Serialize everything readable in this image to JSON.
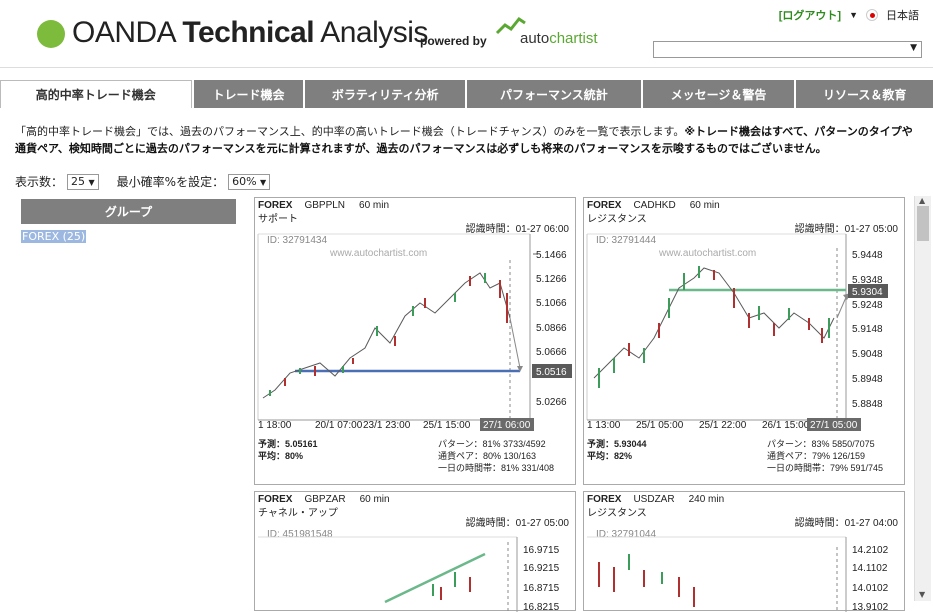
{
  "header": {
    "brand_bold": "OANDA",
    "brand_product_bold": "Technical",
    "brand_product_thin": " Analysis",
    "powered_by": "powered by",
    "partner_pre": "auto",
    "partner_post": "chartist",
    "logout": "[ログアウト]",
    "language": "日本語"
  },
  "tabs": [
    {
      "label": "高的中率トレード機会",
      "active": true
    },
    {
      "label": "トレード機会"
    },
    {
      "label": "ボラティリティ分析"
    },
    {
      "label": "パフォーマンス統計"
    },
    {
      "label": "メッセージ＆警告"
    },
    {
      "label": "リソース＆教育"
    }
  ],
  "description": {
    "normal": "「高的中率トレード機会」では、過去のパフォーマンス上、的中率の高いトレード機会（トレードチャンス）のみを一覧で表示します。",
    "bold": "※トレード機会はすべて、パターンのタイプや通貨ペア、検知時間ごとに過去のパフォーマンスを元に計算されますが、過去のパフォーマンスは必ずしも将来のパフォーマンスを示唆するものではございません。"
  },
  "filters": {
    "count_label": "表示数：",
    "count_value": "25",
    "prob_label": "最小確率%を設定：",
    "prob_value": "60%"
  },
  "group": {
    "header": "グループ",
    "item": "FOREX (25)"
  },
  "watermark": "www.autochartist.com",
  "cards": [
    {
      "market": "FOREX",
      "pair": "GBPPLN",
      "interval": "60 min",
      "pattern": "サポート",
      "recognized": "認識時間：01-27 06:00",
      "id": "ID: 32791434",
      "y_ticks": [
        "5.1466",
        "5.1266",
        "5.1066",
        "5.0866",
        "5.0666",
        "5.0516",
        "5.0266"
      ],
      "x_ticks": [
        "1 18:00",
        "20/1 07:00",
        "23/1 23:00",
        "25/1 15:00",
        "27/1 06:00"
      ],
      "forecast_label": "予測：5.05161",
      "avg_label": "平均：80%",
      "pattern_stat": "パターン：81% 3733/4592",
      "pair_stat": "通貨ペア：80% 130/163",
      "day_stat": "一日の時間帯：81% 331/408"
    },
    {
      "market": "FOREX",
      "pair": "CADHKD",
      "interval": "60 min",
      "pattern": "レジスタンス",
      "recognized": "認識時間：01-27 05:00",
      "id": "ID: 32791444",
      "y_ticks": [
        "5.9448",
        "5.9348",
        "5.9304",
        "5.9248",
        "5.9148",
        "5.9048",
        "5.8948",
        "5.8848"
      ],
      "x_ticks": [
        "1 13:00",
        "25/1 05:00",
        "25/1 22:00",
        "26/1 15:00",
        "27/1 05:00"
      ],
      "forecast_label": "予測：5.93044",
      "avg_label": "平均：82%",
      "pattern_stat": "パターン：83% 5850/7075",
      "pair_stat": "通貨ペア：79% 126/159",
      "day_stat": "一日の時間帯：79% 591/745"
    },
    {
      "market": "FOREX",
      "pair": "GBPZAR",
      "interval": "60 min",
      "pattern": "チャネル・アップ",
      "recognized": "認識時間：01-27 05:00",
      "id": "ID: 451981548",
      "y_ticks": [
        "16.9715",
        "16.9215",
        "16.8715",
        "16.8215"
      ]
    },
    {
      "market": "FOREX",
      "pair": "USDZAR",
      "interval": "240 min",
      "pattern": "レジスタンス",
      "recognized": "認識時間：01-27 04:00",
      "id": "ID: 32791044",
      "y_ticks": [
        "14.2102",
        "14.1102",
        "14.0102",
        "13.9102"
      ]
    }
  ]
}
